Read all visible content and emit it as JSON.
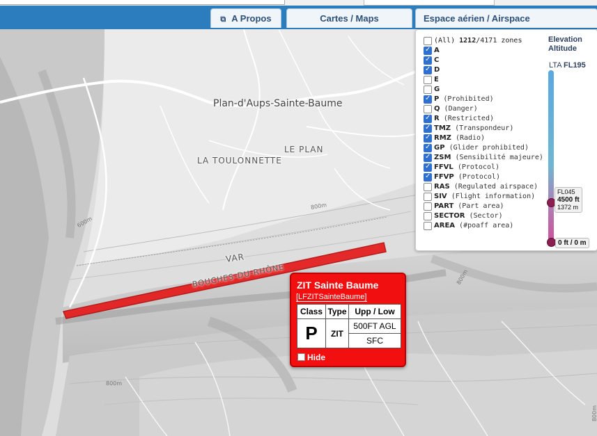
{
  "nav": {
    "about_label": "A Propos",
    "maps_label": "Cartes / Maps",
    "airspace_label": "Espace aérien / Airspace"
  },
  "map": {
    "labels": {
      "town": "Plan-d'Aups-Sainte-Baume",
      "le_plan": "LE PLAN",
      "toulonnette": "LA TOULONNETTE",
      "var": "VAR",
      "bouches": "BOUCHES-DU-RHÔNE",
      "alt_800_a": "800m",
      "alt_800_b": "800m",
      "alt_800_c": "800m",
      "alt_800_d": "800m",
      "alt_600": "600m"
    },
    "zone_color": "#e41a1a"
  },
  "layers": {
    "all": {
      "label": "(All)",
      "shown": "1212",
      "total": "/4171 zones",
      "checked": false
    },
    "items": [
      {
        "code": "A",
        "desc": "",
        "checked": true
      },
      {
        "code": "C",
        "desc": "",
        "checked": true
      },
      {
        "code": "D",
        "desc": "",
        "checked": true
      },
      {
        "code": "E",
        "desc": "",
        "checked": false
      },
      {
        "code": "G",
        "desc": "",
        "checked": false
      },
      {
        "code": "P",
        "desc": "(Prohibited)",
        "checked": true
      },
      {
        "code": "Q",
        "desc": "(Danger)",
        "checked": false
      },
      {
        "code": "R",
        "desc": "(Restricted)",
        "checked": true
      },
      {
        "code": "TMZ",
        "desc": "(Transpondeur)",
        "checked": true
      },
      {
        "code": "RMZ",
        "desc": "(Radio)",
        "checked": true
      },
      {
        "code": "GP",
        "desc": "(Glider prohibited)",
        "checked": true
      },
      {
        "code": "ZSM",
        "desc": "(Sensibilité majeure)",
        "checked": true
      },
      {
        "code": "FFVL",
        "desc": "(Protocol)",
        "checked": true
      },
      {
        "code": "FFVP",
        "desc": "(Protocol)",
        "checked": true
      },
      {
        "code": "RAS",
        "desc": "(Regulated airspace)",
        "checked": false
      },
      {
        "code": "SIV",
        "desc": "(Flight information)",
        "checked": false
      },
      {
        "code": "PART",
        "desc": "(Part area)",
        "checked": false
      },
      {
        "code": "SECTOR",
        "desc": "(Sector)",
        "checked": false
      },
      {
        "code": "AREA",
        "desc": "(#poaff area)",
        "checked": false
      }
    ],
    "elevation": {
      "title1": "Elevation",
      "title2": "Altitude",
      "lta_prefix": "LTA",
      "lta_value": "FL195",
      "upper_fl": "FL045",
      "upper_ft": "4500 ft",
      "upper_m": "1372 m",
      "lower": "0 ft / 0 m",
      "upper_level_ft": 4500,
      "max_level_ft": 19500
    }
  },
  "popup": {
    "title": "ZIT Sainte Baume",
    "id": "[LFZITSainteBaume]",
    "headers": [
      "Class",
      "Type",
      "Upp / Low"
    ],
    "class": "P",
    "type": "ZIT",
    "upper": "500FT AGL",
    "lower": "SFC",
    "hide_label": "Hide"
  }
}
